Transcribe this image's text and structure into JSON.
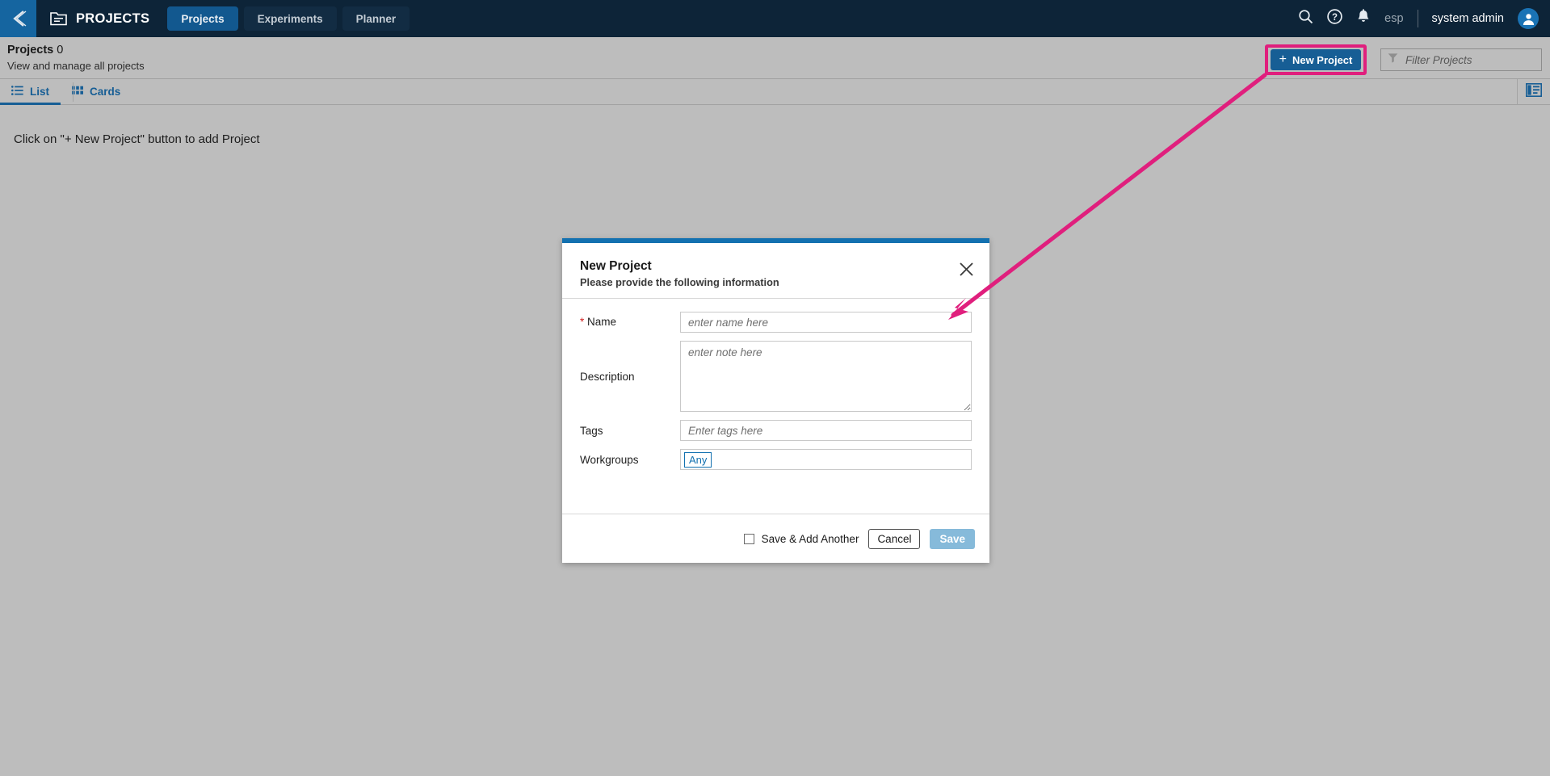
{
  "topbar": {
    "back_icon": "chevron-left-back-icon",
    "app_icon": "folder-projects-icon",
    "app_title": "PROJECTS",
    "tabs": [
      {
        "label": "Projects",
        "active": true
      },
      {
        "label": "Experiments",
        "active": false
      },
      {
        "label": "Planner",
        "active": false
      }
    ],
    "search_icon": "search-icon",
    "help_icon": "help-circle-icon",
    "notifications_icon": "bell-icon",
    "language": "esp",
    "user_name": "system admin",
    "avatar_icon": "user-avatar-icon"
  },
  "page_header": {
    "title": "Projects",
    "count": "0",
    "subtitle": "View and manage all projects",
    "new_project_label": "New Project",
    "new_project_plus": "+",
    "filter_placeholder": "Filter Projects",
    "filter_value": "",
    "filter_icon": "funnel-filter-icon",
    "highlight_color": "#e01f7d",
    "button_color": "#175e95"
  },
  "view_tabs": [
    {
      "label": "List",
      "icon": "list-view-icon",
      "active": true
    },
    {
      "label": "Cards",
      "icon": "grid-cards-icon",
      "active": false
    }
  ],
  "panel_toggle_icon": "side-panel-toggle-icon",
  "content": {
    "empty_message": "Click on \"+ New Project\" button to add Project"
  },
  "dialog": {
    "accent_color": "#1371b0",
    "title": "New Project",
    "subtitle": "Please provide the following information",
    "close_icon": "close-x-icon",
    "fields": {
      "name": {
        "label": "Name",
        "required_marker": "*",
        "placeholder": "enter name here",
        "value": ""
      },
      "description": {
        "label": "Description",
        "placeholder": "enter note here",
        "value": ""
      },
      "tags": {
        "label": "Tags",
        "placeholder": "Enter tags here",
        "value": ""
      },
      "workgroups": {
        "label": "Workgroups",
        "chip": "Any"
      }
    },
    "footer": {
      "save_add_another_label": "Save & Add Another",
      "save_add_another_checked": false,
      "cancel_label": "Cancel",
      "save_label": "Save"
    }
  },
  "annotation": {
    "color": "#e01f7d",
    "type": "arrow-from-new-project-button-to-name-field"
  }
}
